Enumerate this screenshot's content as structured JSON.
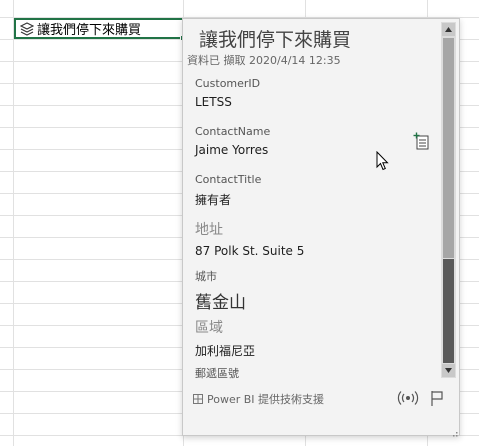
{
  "cell": {
    "text": "讓我們停下來購買"
  },
  "card": {
    "title": "讓我們停下來購買",
    "subtitle": "資料已 擷取 2020/4/14 12:35",
    "fields": [
      {
        "label": "CustomerID",
        "value": "LETSS"
      },
      {
        "label": "ContactName",
        "value": "Jaime Yorres"
      },
      {
        "label": "ContactTitle",
        "value": "擁有者"
      },
      {
        "label": "地址",
        "value": "87 Polk St. Suite 5"
      },
      {
        "label": "城市",
        "value": "舊金山"
      },
      {
        "label": "區域",
        "value": "加利福尼亞"
      },
      {
        "label": "郵遞區號",
        "value": ""
      }
    ],
    "footer_text": "Power BI 提供技術支援"
  },
  "colors": {
    "excel_green": "#217346",
    "card_bg": "#f3f3f3",
    "scroll_dark": "#595959"
  },
  "icons": [
    "data-type-icon",
    "add-to-grid-icon",
    "live-data-icon",
    "flag-icon",
    "table-icon",
    "resize-grip-icon",
    "mouse-cursor-icon"
  ]
}
